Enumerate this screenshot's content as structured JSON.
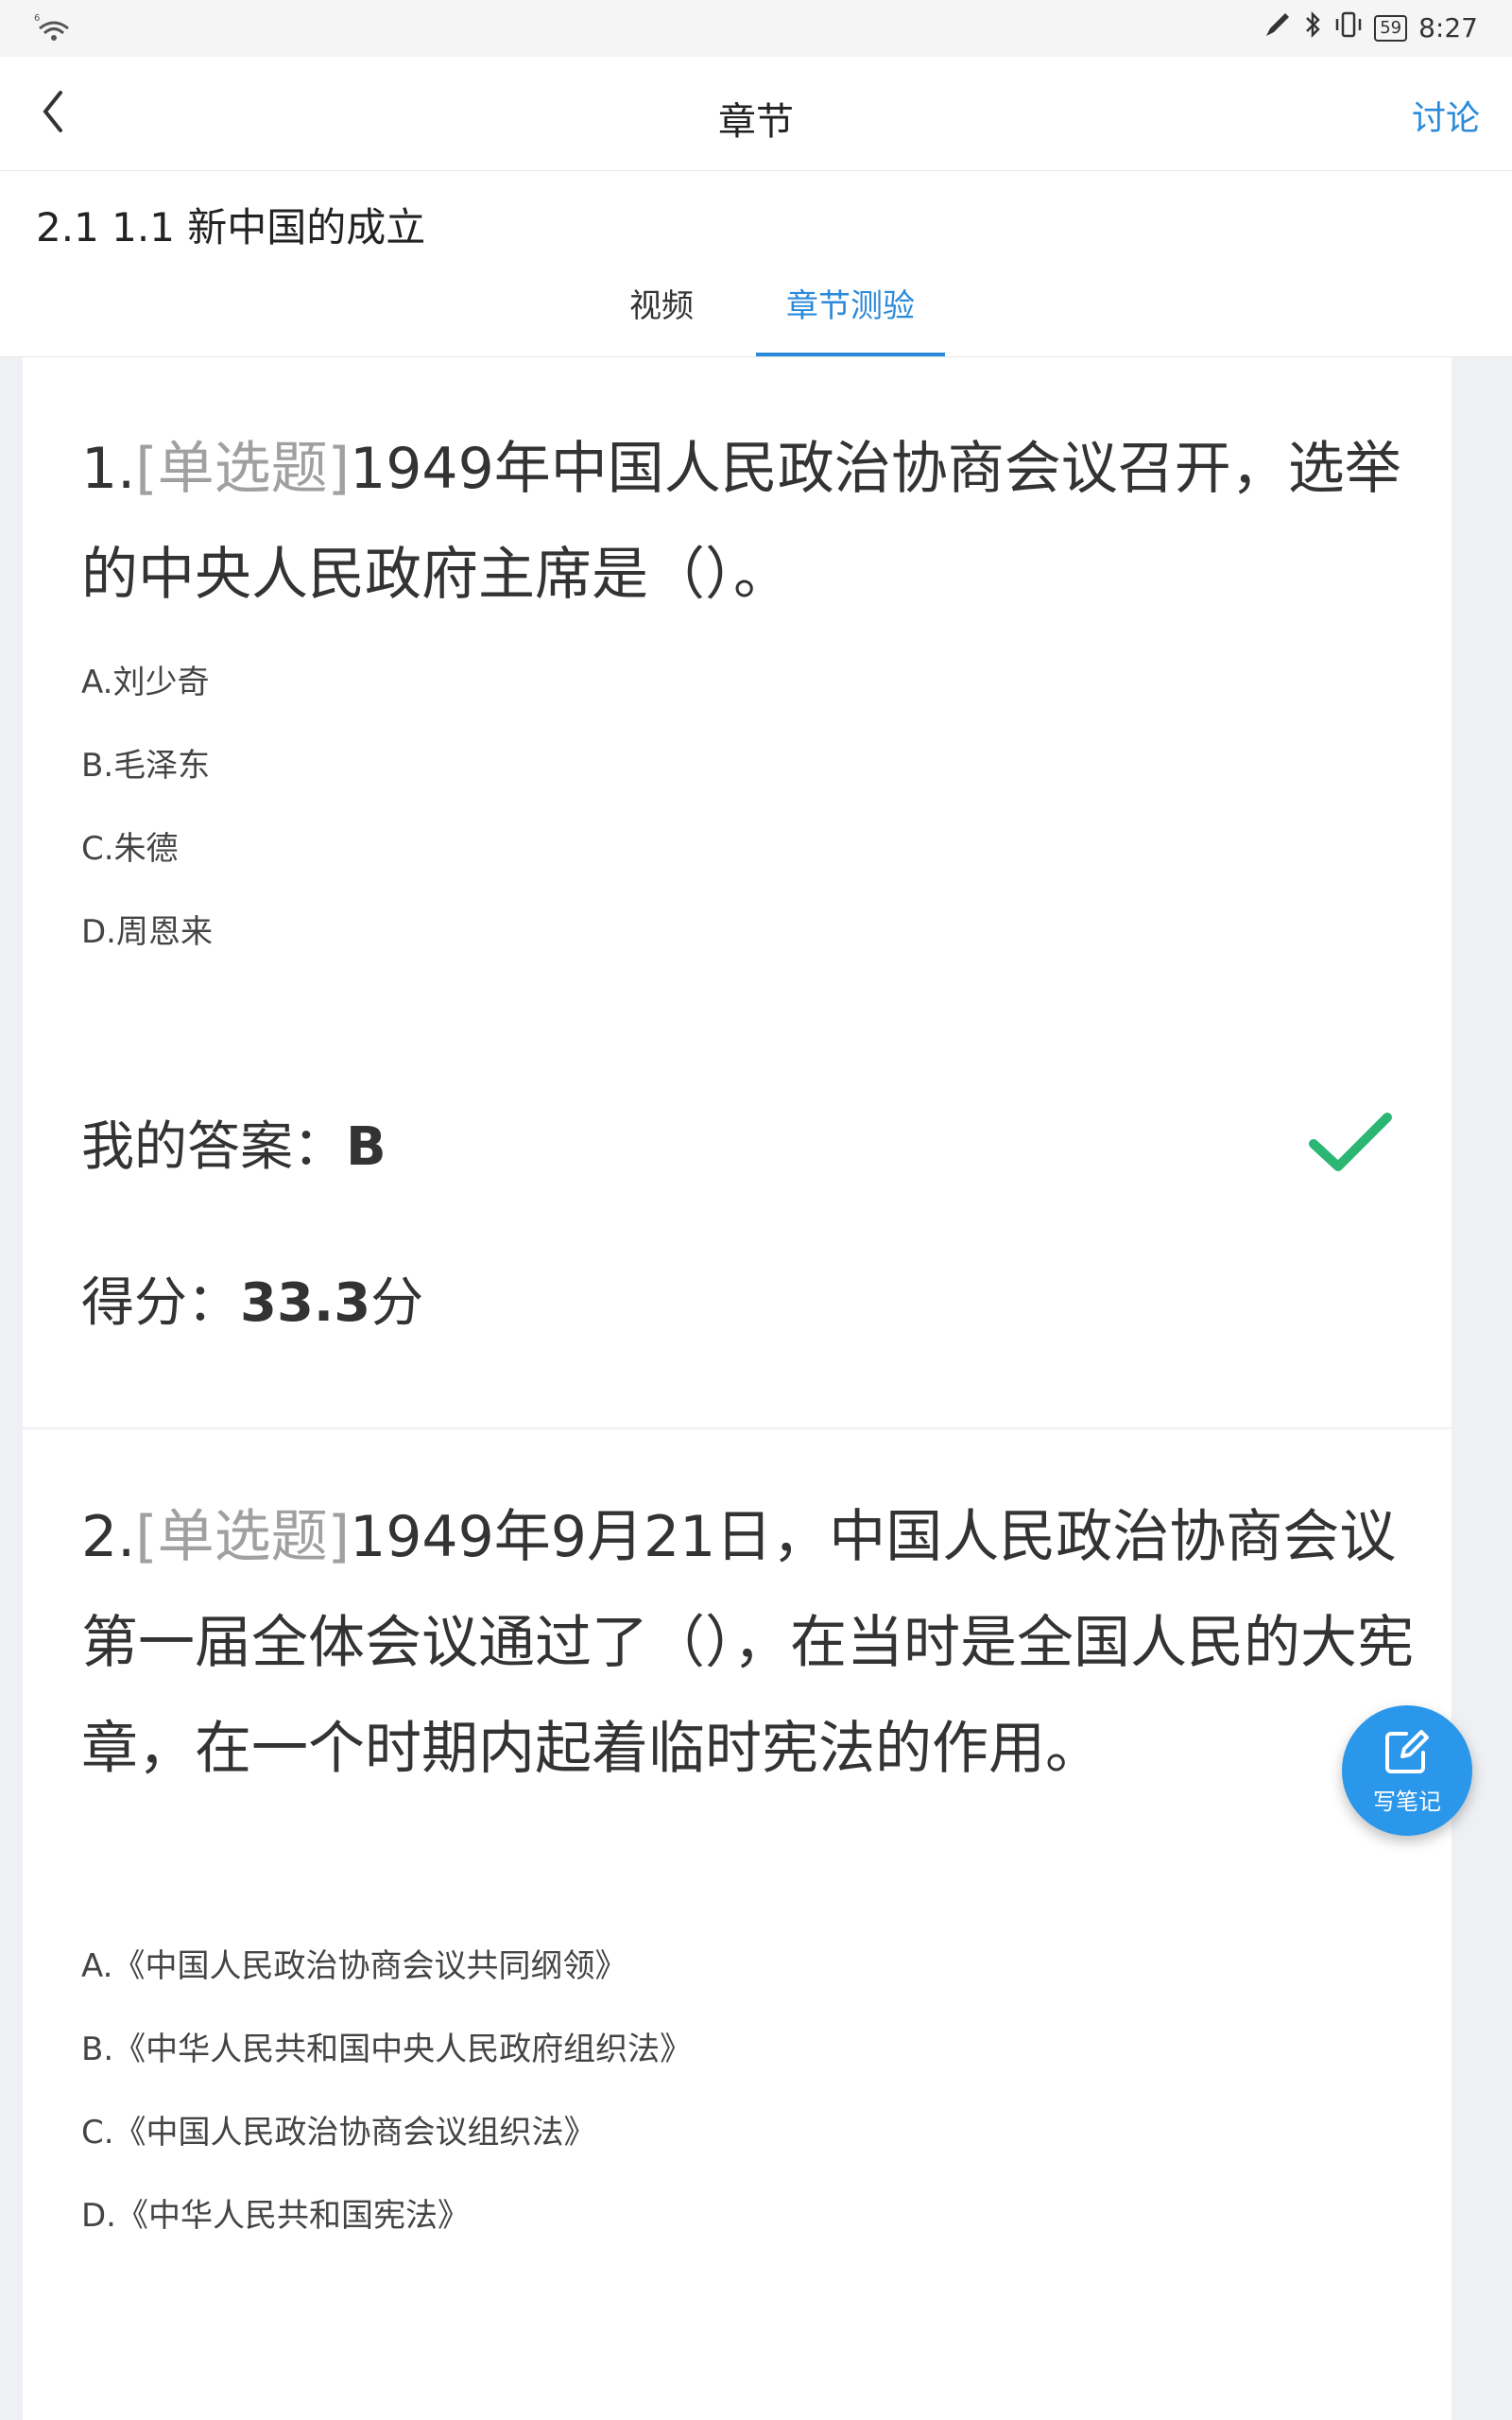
{
  "status_bar": {
    "signal_label": "6",
    "battery": "59",
    "time": "8:27"
  },
  "nav": {
    "title": "章节",
    "right_action": "讨论"
  },
  "chapter_title": "2.1 1.1 新中国的成立",
  "tabs": [
    {
      "label": "视频",
      "active": false
    },
    {
      "label": "章节测验",
      "active": true
    }
  ],
  "questions": [
    {
      "number": "1.",
      "type": "[单选题]",
      "text": "1949年中国人民政治协商会议召开，选举的中央人民政府主席是（）。",
      "options": [
        "A.刘少奇",
        "B.毛泽东",
        "C.朱德",
        "D.周恩来"
      ],
      "answer_label": "我的答案：",
      "answer_value": "B",
      "score_label": "得分：",
      "score_value": "33.3",
      "score_unit": "分"
    },
    {
      "number": "2.",
      "type": "[单选题]",
      "text": "1949年9月21日，中国人民政治协商会议第一届全体会议通过了（），在当时是全国人民的大宪章，在一个时期内起着临时宪法的作用。",
      "options": [
        "A.《中国人民政治协商会议共同纲领》",
        "B.《中华人民共和国中央人民政府组织法》",
        "C.《中国人民政治协商会议组织法》",
        "D.《中华人民共和国宪法》"
      ]
    }
  ],
  "fab": {
    "label": "写笔记"
  },
  "colors": {
    "accent": "#2a8ad9",
    "check": "#2bb673",
    "qtype": "#a0a0a0"
  }
}
